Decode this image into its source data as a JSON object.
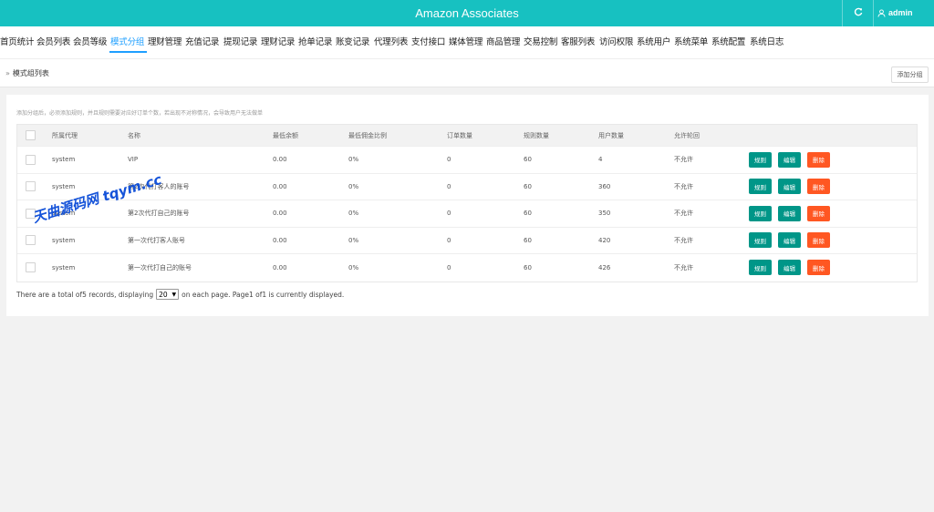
{
  "header": {
    "title": "Amazon Associates",
    "user": "admin",
    "refresh_icon": "refresh-icon",
    "user_icon": "user-icon"
  },
  "nav": {
    "items": [
      "首页统计",
      "会员列表",
      "会员等级",
      "模式分组",
      "理财管理",
      "充值记录",
      "提现记录",
      "理财记录",
      "抢单记录",
      "账变记录",
      "代理列表",
      "支付接口",
      "媒体管理",
      "商品管理",
      "交易控制",
      "客服列表",
      "访问权限",
      "系统用户",
      "系统菜单",
      "系统配置",
      "系统日志"
    ],
    "active": "模式分组"
  },
  "breadcrumb": {
    "text": "模式组列表",
    "add_button": "添加分组"
  },
  "panel": {
    "hint": "添加分组后，必须添加规则，并且规则需要对应好订单个数，若出现不对称情况，会导致用户无法做单"
  },
  "table": {
    "headers": [
      "所属代理",
      "名称",
      "最低余额",
      "最低佣金比例",
      "订单数量",
      "规则数量",
      "用户数量",
      "允许轮回"
    ],
    "rows": [
      {
        "agent": "system",
        "name": "VIP",
        "min_balance": "0.00",
        "min_commission": "0%",
        "orders": "0",
        "rules": "60",
        "users": "4",
        "cycle": "不允许"
      },
      {
        "agent": "system",
        "name": "第2次代打客人的账号",
        "min_balance": "0.00",
        "min_commission": "0%",
        "orders": "0",
        "rules": "60",
        "users": "360",
        "cycle": "不允许"
      },
      {
        "agent": "system",
        "name": "第2次代打自己的账号",
        "min_balance": "0.00",
        "min_commission": "0%",
        "orders": "0",
        "rules": "60",
        "users": "350",
        "cycle": "不允许"
      },
      {
        "agent": "system",
        "name": "第一次代打客人账号",
        "min_balance": "0.00",
        "min_commission": "0%",
        "orders": "0",
        "rules": "60",
        "users": "420",
        "cycle": "不允许"
      },
      {
        "agent": "system",
        "name": "第一次代打自己的账号",
        "min_balance": "0.00",
        "min_commission": "0%",
        "orders": "0",
        "rules": "60",
        "users": "426",
        "cycle": "不允许"
      }
    ],
    "actions": {
      "rules": "规则",
      "edit": "编辑",
      "delete": "删除"
    }
  },
  "pager": {
    "before": "There are a total of5 records, displaying",
    "page_size": "20",
    "after": "on each page. Page1 of1 is currently displayed."
  },
  "watermark": "天曲源码网 tqym.cc",
  "colors": {
    "header": "#17c1c1",
    "active": "#1e9fff",
    "green": "#009688",
    "red": "#ff5722"
  }
}
